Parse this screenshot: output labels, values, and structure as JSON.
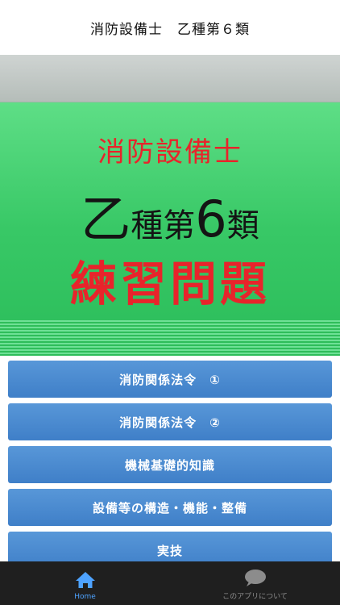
{
  "nav": {
    "title": "消防設備士　乙種第６類"
  },
  "banner": {
    "line1": "消防設備士",
    "line2_a": "乙",
    "line2_b": "種第",
    "line2_c": "6",
    "line2_d": "類",
    "line3": "練習問題"
  },
  "menu": [
    {
      "label": "消防関係法令　①"
    },
    {
      "label": "消防関係法令　②"
    },
    {
      "label": "機械基礎的知識"
    },
    {
      "label": "設備等の構造・機能・整備"
    },
    {
      "label": "実技"
    }
  ],
  "tabs": [
    {
      "label": "Home",
      "icon": "home-icon"
    },
    {
      "label": "このアプリについて",
      "icon": "speech-bubble-icon"
    }
  ],
  "colors": {
    "accent": "#4ea3ff",
    "button": "#4a8bd1",
    "banner": "#3ccb6b",
    "title_red": "#e8242b"
  }
}
